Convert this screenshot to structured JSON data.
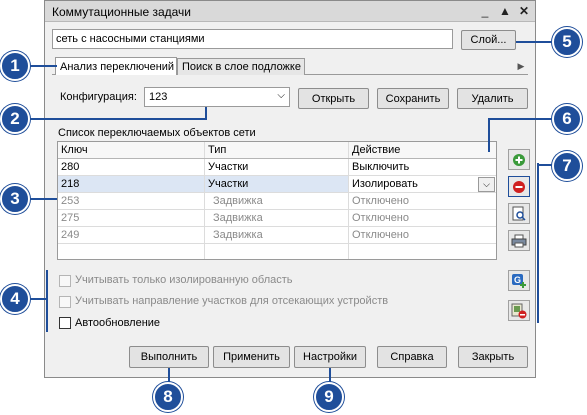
{
  "window": {
    "title": "Коммутационные задачи"
  },
  "layer_field": {
    "value": "сеть с насосными станциями"
  },
  "layer_button": {
    "label": "Слой..."
  },
  "tabs": [
    {
      "label": "Анализ переключений",
      "active": true
    },
    {
      "label": "Поиск в слое подложке",
      "active": false
    }
  ],
  "config": {
    "label": "Конфигурация:",
    "value": "123",
    "open": "Открыть",
    "save": "Сохранить",
    "delete": "Удалить"
  },
  "list": {
    "title": "Список переключаемых объектов сети",
    "headers": [
      "Ключ",
      "Тип",
      "Действие"
    ],
    "rows": [
      {
        "key": "280",
        "type": "Участки",
        "action": "Выключить",
        "state": "normal"
      },
      {
        "key": "218",
        "type": "Участки",
        "action": "Изолировать",
        "state": "selected"
      },
      {
        "key": "253",
        "type": "Задвижка",
        "action": "Отключено",
        "state": "disabled"
      },
      {
        "key": "275",
        "type": "Задвижка",
        "action": "Отключено",
        "state": "disabled"
      },
      {
        "key": "249",
        "type": "Задвижка",
        "action": "Отключено",
        "state": "disabled"
      }
    ]
  },
  "options": {
    "isolated_only": "Учитывать только изолированную область",
    "cut_direction": "Учитывать направление участков для отсекающих устройств",
    "auto_update": "Автообновление"
  },
  "footer": {
    "run": "Выполнить",
    "apply": "Применить",
    "settings": "Настройки",
    "help": "Справка",
    "close": "Закрыть"
  },
  "callouts": [
    "1",
    "2",
    "3",
    "4",
    "5",
    "6",
    "7",
    "8",
    "9"
  ],
  "colors": {
    "callout": "#1f4e9a",
    "selected_row": "#dce6f4"
  }
}
